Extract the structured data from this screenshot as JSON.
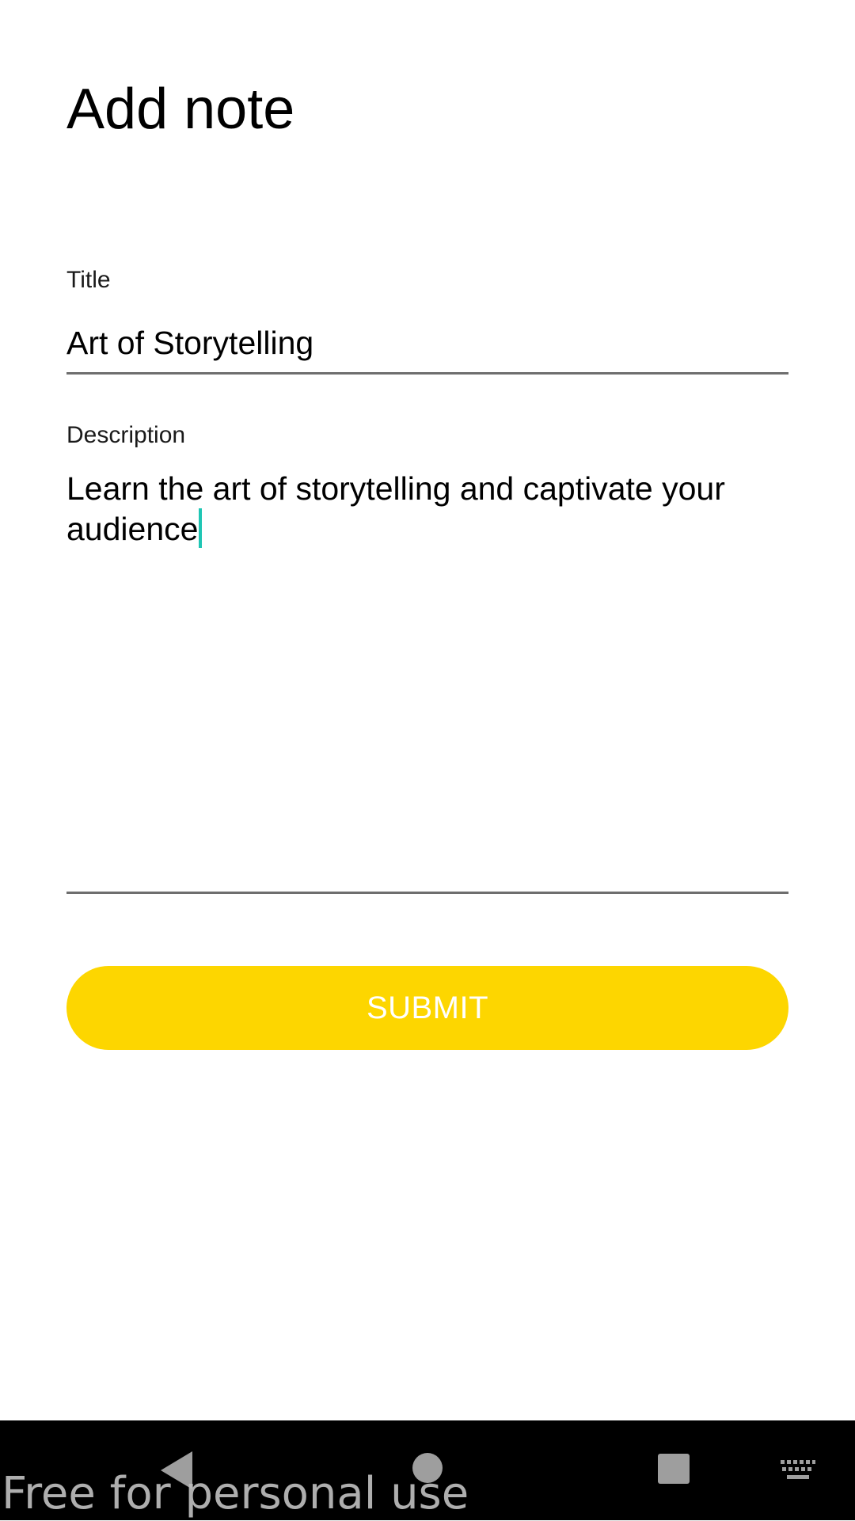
{
  "page": {
    "title": "Add note"
  },
  "form": {
    "title_field": {
      "label": "Title",
      "value": "Art of Storytelling"
    },
    "description_field": {
      "label": "Description",
      "value": "Learn the art of storytelling and captivate your audience"
    },
    "submit_label": "SUBMIT"
  },
  "nav_bar": {
    "back_icon": "triangle-back-icon",
    "home_icon": "circle-home-icon",
    "recents_icon": "square-recents-icon",
    "keyboard_icon": "keyboard-icon"
  },
  "watermark": "Free for personal use",
  "colors": {
    "accent": "#FDD600",
    "caret": "#1FC6B4",
    "underline": "#6E6E6E",
    "nav_icons": "#9E9E9E",
    "nav_background": "#000000"
  }
}
